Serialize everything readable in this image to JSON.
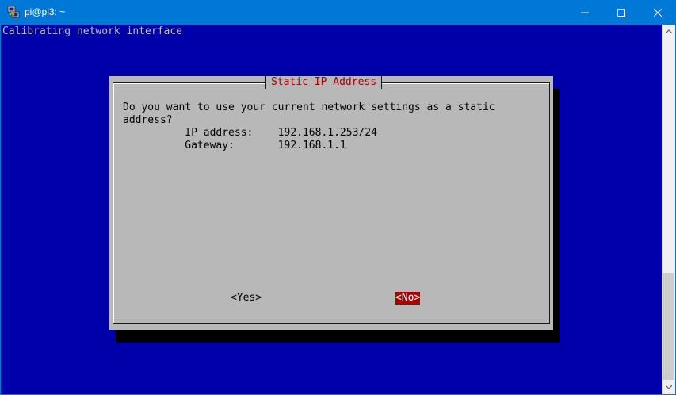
{
  "window": {
    "title": "pi@pi3: ~",
    "app_icon": "putty-icon",
    "buttons": [
      "minimize-icon",
      "maximize-icon",
      "close-icon"
    ]
  },
  "terminal": {
    "status_line": "Calibrating network interface",
    "dialog": {
      "title": "Static IP Address",
      "body_line1": "Do you want to use your current network settings as a static",
      "body_line2": "address?",
      "ip_line": "          IP address:    192.168.1.253/24",
      "gateway_line": "          Gateway:       192.168.1.1",
      "yes_label": "<Yes>",
      "no_label": "<No>",
      "selected_button": "No"
    }
  },
  "colors": {
    "titlebar": "#0078d7",
    "terminal_bg": "#0000aa",
    "dialog_bg": "#b8b8b8",
    "dialog_title": "#aa0000",
    "selected_button_bg": "#aa0000"
  }
}
